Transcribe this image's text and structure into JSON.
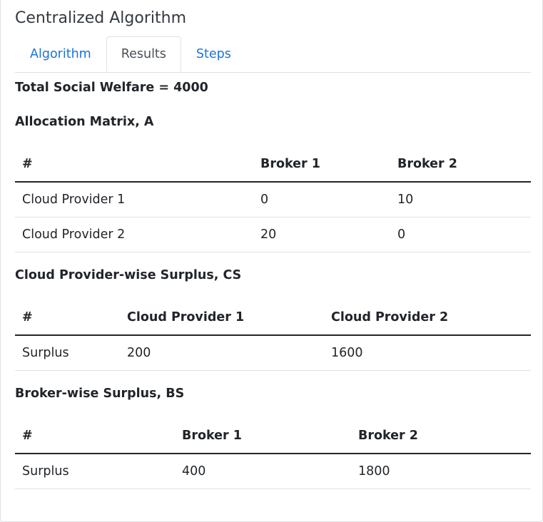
{
  "card": {
    "title": "Centralized Algorithm"
  },
  "tabs": [
    {
      "label": "Algorithm",
      "active": false
    },
    {
      "label": "Results",
      "active": true
    },
    {
      "label": "Steps",
      "active": false
    }
  ],
  "results": {
    "welfare_label": "Total Social Welfare = 4000",
    "allocation": {
      "title": "Allocation Matrix, A",
      "headers": [
        "#",
        "Broker 1",
        "Broker 2"
      ],
      "rows": [
        [
          "Cloud Provider 1",
          "0",
          "10"
        ],
        [
          "Cloud Provider 2",
          "20",
          "0"
        ]
      ]
    },
    "cloud_surplus": {
      "title": "Cloud Provider-wise Surplus, CS",
      "headers": [
        "#",
        "Cloud Provider 1",
        "Cloud Provider 2"
      ],
      "rows": [
        [
          "Surplus",
          "200",
          "1600"
        ]
      ]
    },
    "broker_surplus": {
      "title": "Broker-wise Surplus, BS",
      "headers": [
        "#",
        "Broker 1",
        "Broker 2"
      ],
      "rows": [
        [
          "Surplus",
          "400",
          "1800"
        ]
      ]
    }
  },
  "colors": {
    "link": "#1a73d9",
    "active_tab_text": "#495057",
    "border": "#dee2e6",
    "text": "#212529"
  }
}
